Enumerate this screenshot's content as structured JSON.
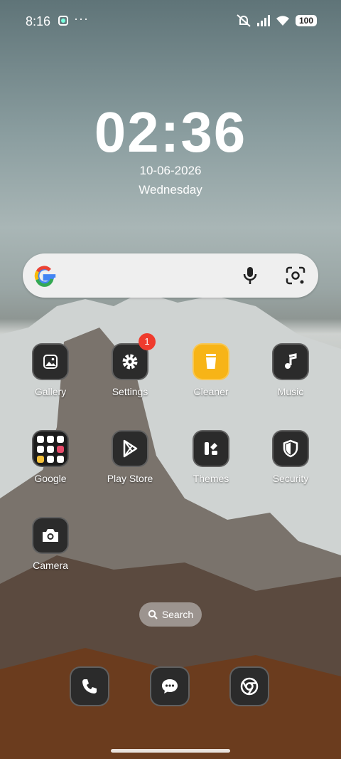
{
  "status_bar": {
    "time": "8:16",
    "overflow": "···",
    "battery": "100",
    "icons": [
      "notification-app-icon",
      "mute-icon",
      "signal-icon",
      "wifi-icon",
      "battery-icon"
    ]
  },
  "clock": {
    "time": "02:36",
    "date": "10-06-2026",
    "weekday": "Wednesday"
  },
  "search_widget": {
    "icons": [
      "google-logo-icon",
      "mic-icon",
      "lens-icon"
    ]
  },
  "apps": [
    {
      "label": "Gallery",
      "icon": "gallery-icon"
    },
    {
      "label": "Settings",
      "icon": "gear-icon",
      "badge": "1"
    },
    {
      "label": "Cleaner",
      "icon": "trash-icon"
    },
    {
      "label": "Music",
      "icon": "music-note-icon"
    },
    {
      "label": "Google",
      "icon": "folder-icon"
    },
    {
      "label": "Play Store",
      "icon": "play-store-icon"
    },
    {
      "label": "Themes",
      "icon": "themes-icon"
    },
    {
      "label": "Security",
      "icon": "shield-icon"
    },
    {
      "label": "Camera",
      "icon": "camera-icon"
    }
  ],
  "home_search": {
    "label": "Search"
  },
  "dock": [
    {
      "icon": "phone-icon"
    },
    {
      "icon": "message-icon"
    },
    {
      "icon": "chrome-icon"
    }
  ]
}
